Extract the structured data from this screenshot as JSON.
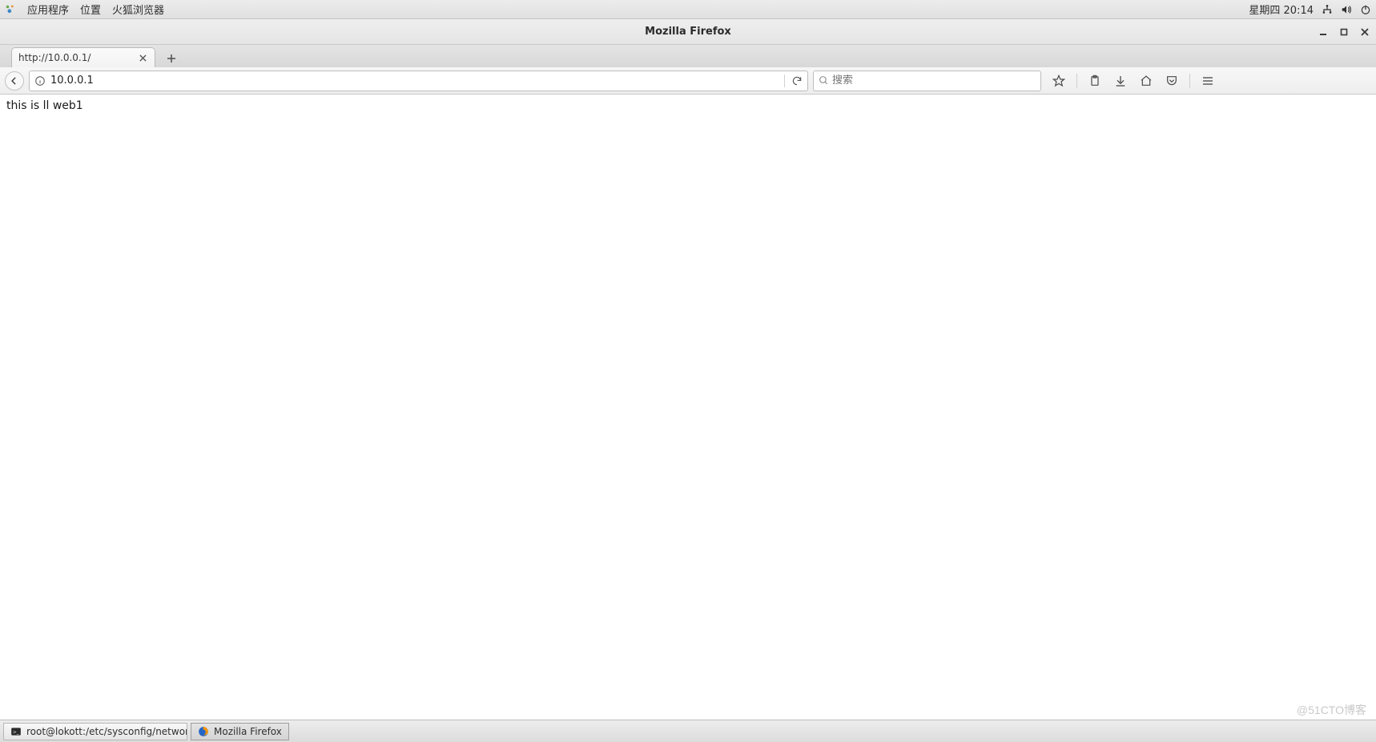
{
  "gnome_panel": {
    "menus": {
      "applications": "应用程序",
      "places": "位置",
      "firefox": "火狐浏览器"
    },
    "clock": "星期四 20:14"
  },
  "window": {
    "title": "Mozilla Firefox"
  },
  "tabs": {
    "active_label": "http://10.0.0.1/"
  },
  "urlbar": {
    "value": "10.0.0.1"
  },
  "searchbar": {
    "placeholder": "搜索"
  },
  "page": {
    "body_text": "this  is  ll  web1"
  },
  "taskbar": {
    "items": [
      {
        "label": "root@lokott:/etc/sysconfig/networ…"
      },
      {
        "label": "Mozilla Firefox"
      }
    ]
  },
  "watermark": "@51CTO博客"
}
